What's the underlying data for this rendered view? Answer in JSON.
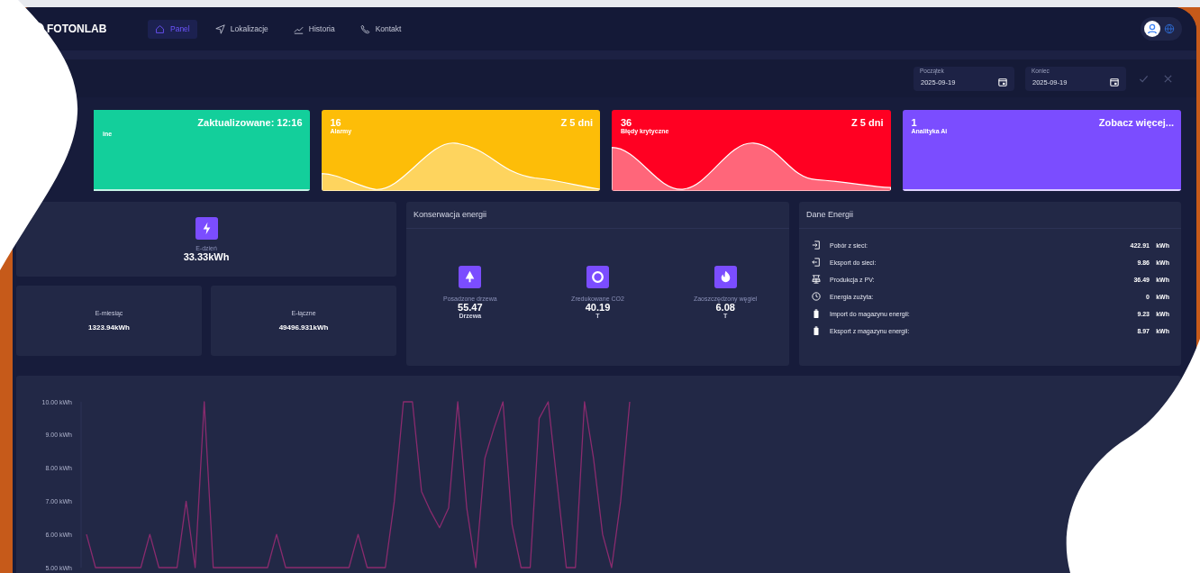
{
  "nav": {
    "brand": "FOTONLAB",
    "items": [
      {
        "label": "Panel",
        "selected": true
      },
      {
        "label": "Lokalizacje",
        "selected": false
      },
      {
        "label": "Historia",
        "selected": false
      },
      {
        "label": "Kontakt",
        "selected": false
      }
    ]
  },
  "filters": {
    "start": {
      "label": "Początek",
      "value": "2025-09-19"
    },
    "end": {
      "label": "Koniec",
      "value": "2025-09-19"
    }
  },
  "status_cards": [
    {
      "label": "ine",
      "note": "Zaktualizowane: 12:16",
      "color": "#13cf9b",
      "sparkline": false
    },
    {
      "value": "16",
      "label": "Alarmy",
      "note": "Z 5 dni",
      "color": "#fdbd08",
      "sparkline": true
    },
    {
      "value": "36",
      "label": "Błędy krytyczne",
      "note": "Z 5 dni",
      "color": "#ff0022",
      "sparkline": true
    },
    {
      "value": "1",
      "label": "Analityka Ai",
      "note": "Zobacz więcej...",
      "color": "#7b4dff",
      "sparkline": false
    }
  ],
  "energy_main": {
    "label": "E-dzień",
    "value": "33.33kWh"
  },
  "energy_small": [
    {
      "label": "E-miesiąc",
      "value": "1323.94kWh"
    },
    {
      "label": "E-łączne",
      "value": "49496.931kWh"
    }
  ],
  "conservation": {
    "title": "Konserwacja energii",
    "items": [
      {
        "label": "Posadzone drzewa",
        "value": "55.47",
        "unit": "Drzewa"
      },
      {
        "label": "Zredukowane CO2",
        "value": "40.19",
        "unit": "T"
      },
      {
        "label": "Zaoszczędzony węgiel",
        "value": "6.08",
        "unit": "T"
      }
    ]
  },
  "energy_data": {
    "title": "Dane Energii",
    "rows": [
      {
        "label": "Pobór z sieci:",
        "value": "422.91",
        "unit": "kWh"
      },
      {
        "label": "Eksport do sieci:",
        "value": "9.86",
        "unit": "kWh"
      },
      {
        "label": "Produkcja z PV:",
        "value": "36.49",
        "unit": "kWh"
      },
      {
        "label": "Energia zużyta:",
        "value": "0",
        "unit": "kWh"
      },
      {
        "label": "Import do magazynu energii:",
        "value": "9.23",
        "unit": "kWh"
      },
      {
        "label": "Eksport z magazynu energii:",
        "value": "8.97",
        "unit": "kWh"
      }
    ]
  },
  "chart": {
    "chart_data": {
      "type": "line",
      "categories": [
        null,
        null,
        null,
        null,
        null,
        null,
        null,
        null,
        null,
        null,
        null,
        null,
        null,
        null,
        null,
        null,
        null,
        null,
        null,
        null,
        null,
        null,
        null,
        null,
        null,
        null,
        null,
        null,
        null,
        null,
        null,
        null,
        null,
        null,
        null,
        null,
        null,
        null,
        null,
        null,
        null,
        null,
        null,
        null,
        null,
        null,
        null,
        null,
        null,
        null,
        null,
        null,
        null,
        null,
        null,
        null,
        null,
        null,
        null,
        null,
        null
      ],
      "ylim": [
        5,
        10
      ],
      "yticks": [
        {
          "value": 10,
          "label": "10.00 kWh"
        },
        {
          "value": 9,
          "label": "9.00 kWh"
        },
        {
          "value": 8,
          "label": "8.00 kWh"
        },
        {
          "value": 7,
          "label": "7.00 kWh"
        },
        {
          "value": 6,
          "label": "6.00 kWh"
        },
        {
          "value": 5,
          "label": "5.00 kWh"
        }
      ],
      "series": [
        {
          "color": "#8a2b6e",
          "values": [
            6,
            5,
            5,
            5,
            5,
            5,
            5,
            6,
            5,
            5,
            5,
            7,
            5,
            10,
            5,
            5,
            5,
            5,
            5,
            5,
            5,
            6,
            5,
            5,
            5,
            5,
            5,
            5,
            5,
            5,
            6,
            5,
            5,
            5,
            7,
            10,
            10,
            7.3,
            6.7,
            6.2,
            6.8,
            10,
            6.8,
            5,
            8.3,
            9.2,
            10,
            6.3,
            5,
            5,
            9.5,
            10,
            7.5,
            5,
            5,
            10,
            8.3,
            6,
            5,
            7,
            10
          ]
        }
      ]
    }
  }
}
